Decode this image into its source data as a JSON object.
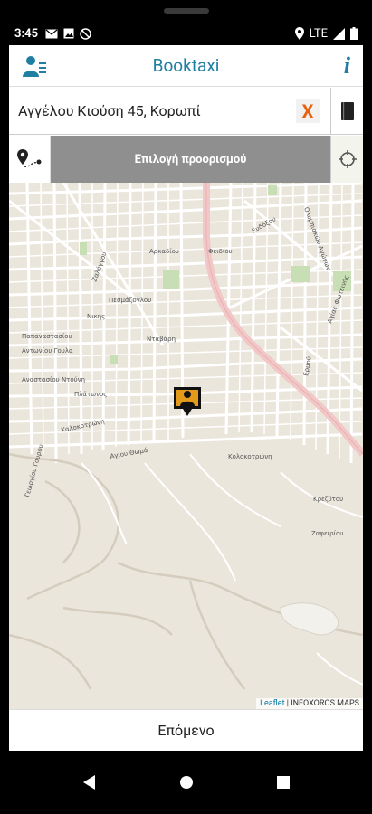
{
  "status": {
    "time": "3:45",
    "network": "LTE"
  },
  "appbar": {
    "title": "Booktaxi",
    "info_glyph": "i"
  },
  "address": {
    "value": "Αγγέλου Κιούση 45, Κορωπί",
    "clear_glyph": "X"
  },
  "destination": {
    "label": "Επιλογή προορισμού"
  },
  "map": {
    "street_labels": [
      "Φειδίου",
      "Ευδόξου",
      "Ολυμπιακών Αγώνων",
      "Αρκαδίου",
      "Ζαλόγγου",
      "Πεσμάζογλου",
      "Νικης",
      "Παπαναστασίου",
      "Αντωνίου Γουλα",
      "Αναστασίου Ντούνη",
      "Πλάτωνος",
      "Νταβάρη",
      "Καλοκοτρώνη",
      "Γεωργίου Γουρου",
      "Αγίου Θωμά",
      "Κολοκοτρώνη",
      "Ερμού",
      "Κρεζύτου",
      "Ζαφειρίου",
      "Αγίας Φωτεινής"
    ]
  },
  "attribution": {
    "leaflet": "Leaflet",
    "separator": " | ",
    "tiles": "INFOXOROS MAPS"
  },
  "next": {
    "label": "Επόμενο"
  },
  "colors": {
    "accent": "#1f7fa3",
    "clear": "#e8620e",
    "map_bg": "#ebe6dc",
    "main_road": "#f2c7c7"
  }
}
